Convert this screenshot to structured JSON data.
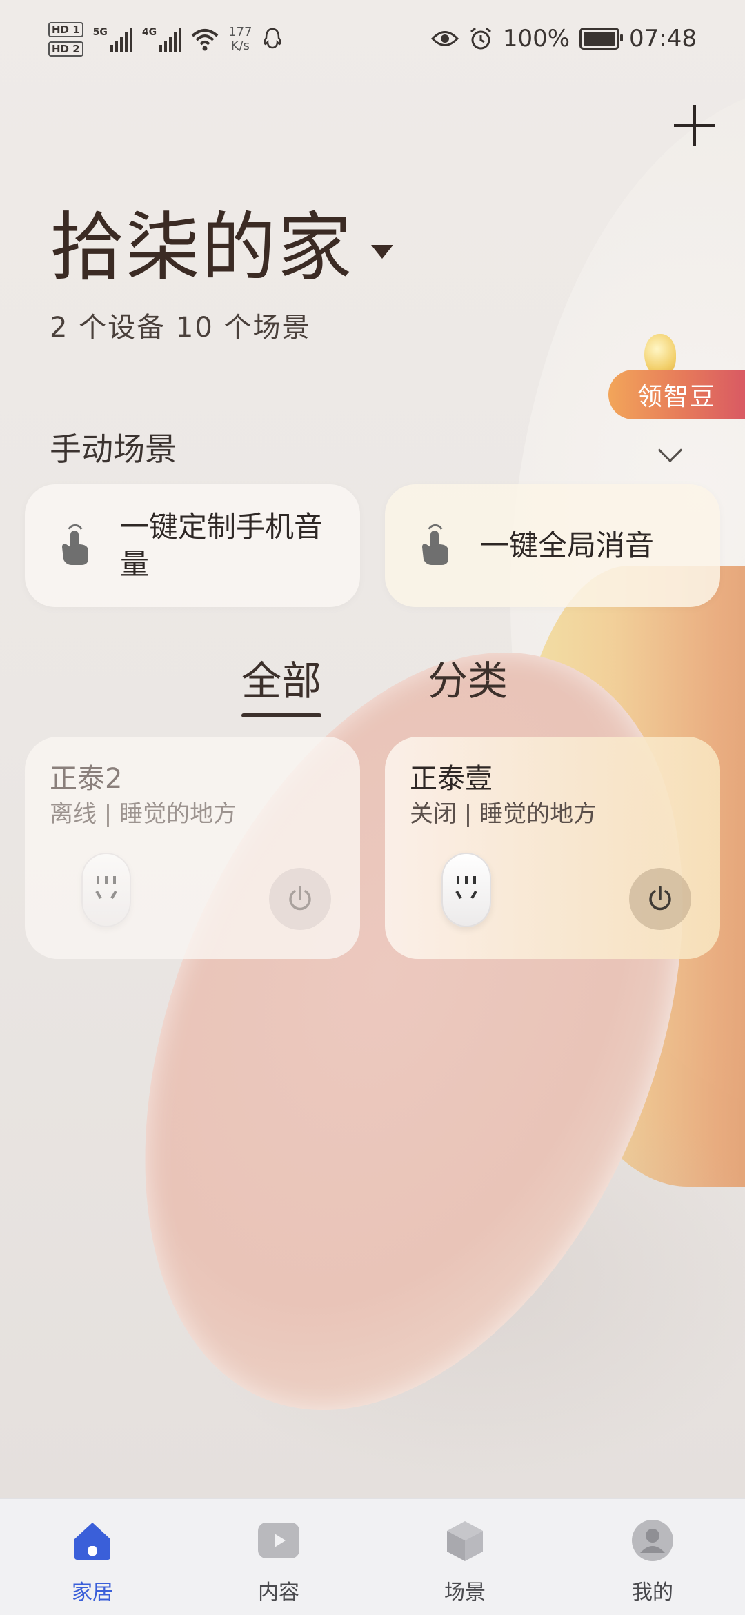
{
  "status_bar": {
    "hd1": "HD 1",
    "hd2": "HD 2",
    "sig1_label": "5G",
    "sig2_label": "4G",
    "net_speed_value": "177",
    "net_speed_unit": "K/s",
    "battery": "100%",
    "time": "07:48"
  },
  "header": {
    "home_name": "拾柒的家",
    "summary": "2 个设备  10 个场景",
    "assistant_label": "领智豆"
  },
  "manual_scenes": {
    "label": "手动场景",
    "items": [
      {
        "label": "一键定制手机音量"
      },
      {
        "label": "一键全局消音"
      }
    ]
  },
  "tabs": [
    {
      "label": "全部",
      "active": true
    },
    {
      "label": "分类",
      "active": false
    }
  ],
  "devices": [
    {
      "name": "正泰2",
      "status": "离线 | 睡觉的地方",
      "online": false
    },
    {
      "name": "正泰壹",
      "status": "关闭 | 睡觉的地方",
      "online": true
    }
  ],
  "nav": [
    {
      "label": "家居",
      "icon": "home-icon",
      "active": true
    },
    {
      "label": "内容",
      "icon": "play-icon",
      "active": false
    },
    {
      "label": "场景",
      "icon": "cube-icon",
      "active": false
    },
    {
      "label": "我的",
      "icon": "profile-icon",
      "active": false
    }
  ],
  "colors": {
    "accent": "#3a5fd9",
    "title_text": "#3b2b24",
    "assistant_gradient_start": "#f2a55a",
    "assistant_gradient_end": "#d95a63"
  }
}
